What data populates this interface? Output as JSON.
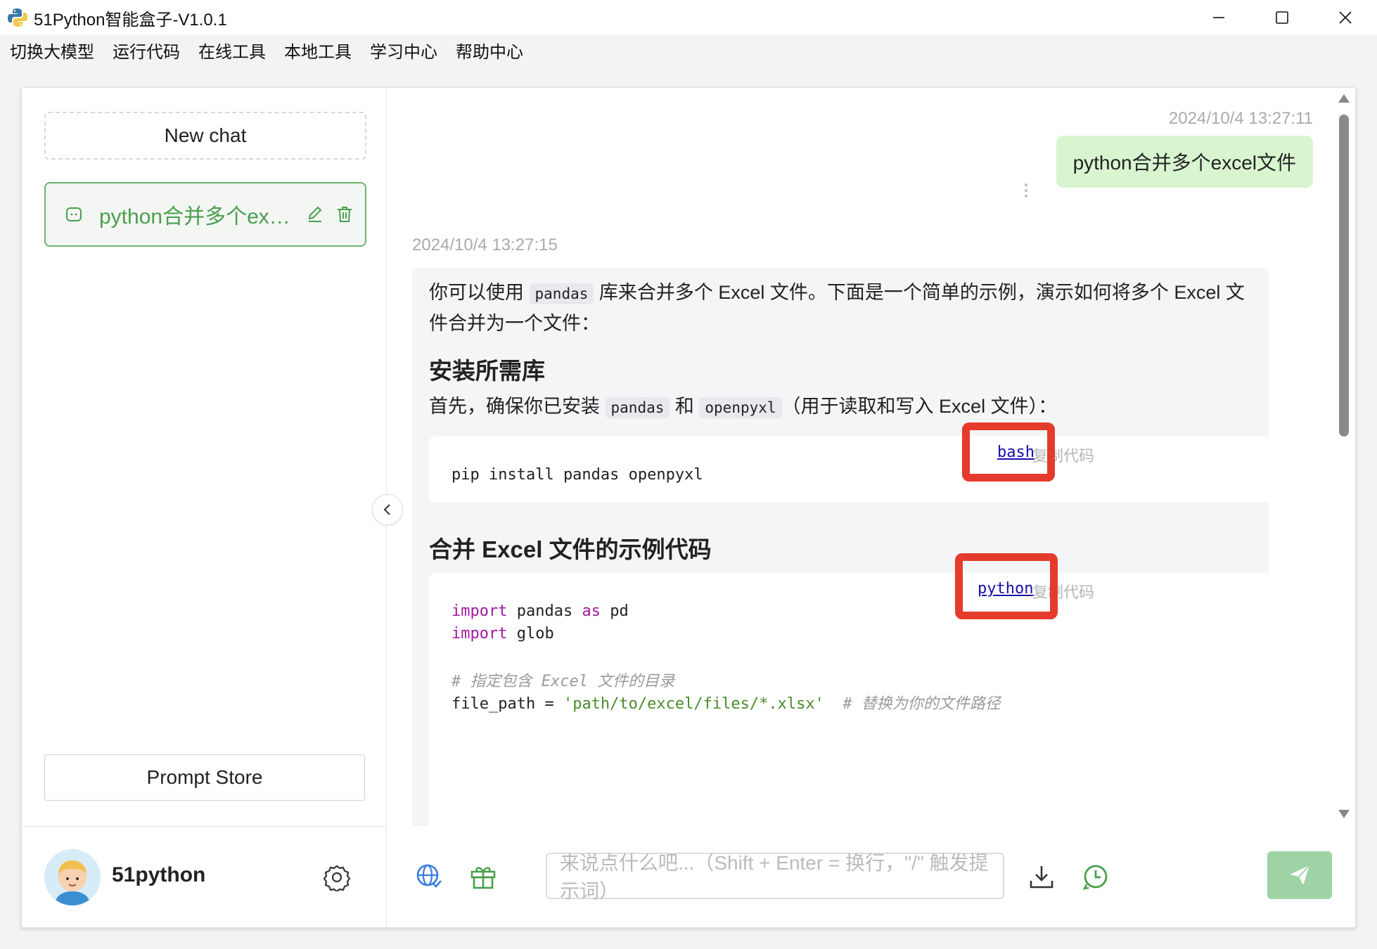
{
  "window": {
    "title": "51Python智能盒子-V1.0.1"
  },
  "menu": [
    "切换大模型",
    "运行代码",
    "在线工具",
    "本地工具",
    "学习中心",
    "帮助中心"
  ],
  "sidebar": {
    "new_chat_label": "New chat",
    "chat_items": [
      {
        "label": "python合并多个excel文件"
      }
    ],
    "prompt_store_label": "Prompt Store",
    "username": "51python"
  },
  "conversation": {
    "user_timestamp": "2024/10/4 13:27:11",
    "user_message": "python合并多个excel文件",
    "assistant_timestamp": "2024/10/4 13:27:15",
    "intro_part1": "你可以使用 ",
    "intro_code": "pandas",
    "intro_part2": " 库来合并多个 Excel 文件。下面是一个简单的示例，演示如何将多个 Excel 文",
    "intro_line2": "件合并为一个文件：",
    "heading1": "安装所需库",
    "install_part1": "首先，确保你已安装 ",
    "install_code1": "pandas",
    "install_part2": " 和 ",
    "install_code2": "openpyxl",
    "install_part3": "（用于读取和写入 Excel 文件）：",
    "code1_lang": "bash",
    "code1_copy": "复制代码",
    "code1_line": "pip install pandas openpyxl",
    "heading2": "合并 Excel 文件的示例代码",
    "code2_lang": "python",
    "code2_copy": "复制代码",
    "code2": {
      "l1_kw": "import",
      "l1_rest": " pandas ",
      "l1_kw2": "as",
      "l1_rest2": " pd",
      "l2_kw": "import",
      "l2_rest": " glob",
      "l3_comment": "# 指定包含 Excel 文件的目录",
      "l4_var": "file_path = ",
      "l4_str": "'path/to/excel/files/*.xlsx'",
      "l4_comment": "  # 替换为你的文件路径"
    }
  },
  "input": {
    "placeholder": "来说点什么吧...（Shift + Enter = 换行，\"/\" 触发提示词）"
  },
  "icons": [
    "python-logo-icon",
    "minimize-icon",
    "maximize-icon",
    "close-icon",
    "chat-bubble-icon",
    "edit-icon",
    "trash-icon",
    "gear-icon",
    "chevron-left-icon",
    "globe-icon",
    "gift-icon",
    "download-icon",
    "history-icon",
    "send-icon",
    "more-dots-icon"
  ],
  "colors": {
    "accent": "#4a9e4d",
    "user_bubble": "#d8f5d0",
    "send_button": "#9ed3a6",
    "highlight_box": "#e53b2c",
    "link": "#1a0dab"
  }
}
